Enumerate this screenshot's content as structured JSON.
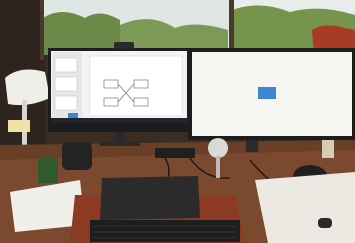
{
  "photo": {
    "slide_title": "",
    "colors": {
      "wall": "#3a2e24",
      "window_glass": "#dfe6e4",
      "foliage": "#6c8a47",
      "curtain": "#a93a24",
      "monitor_bezel": "#1c1d1f",
      "left_screen": "#f3f3f1",
      "right_screen": "#f5f5f2",
      "taskbar": "#20242b",
      "accent_blue": "#3d86d6",
      "desk_wood": "#7b4a2e",
      "leather_mat": "#8c3a22",
      "laptop": "#2b2b2b",
      "paper": "#f1efe9",
      "lamp_shade": "#efeee8"
    }
  }
}
